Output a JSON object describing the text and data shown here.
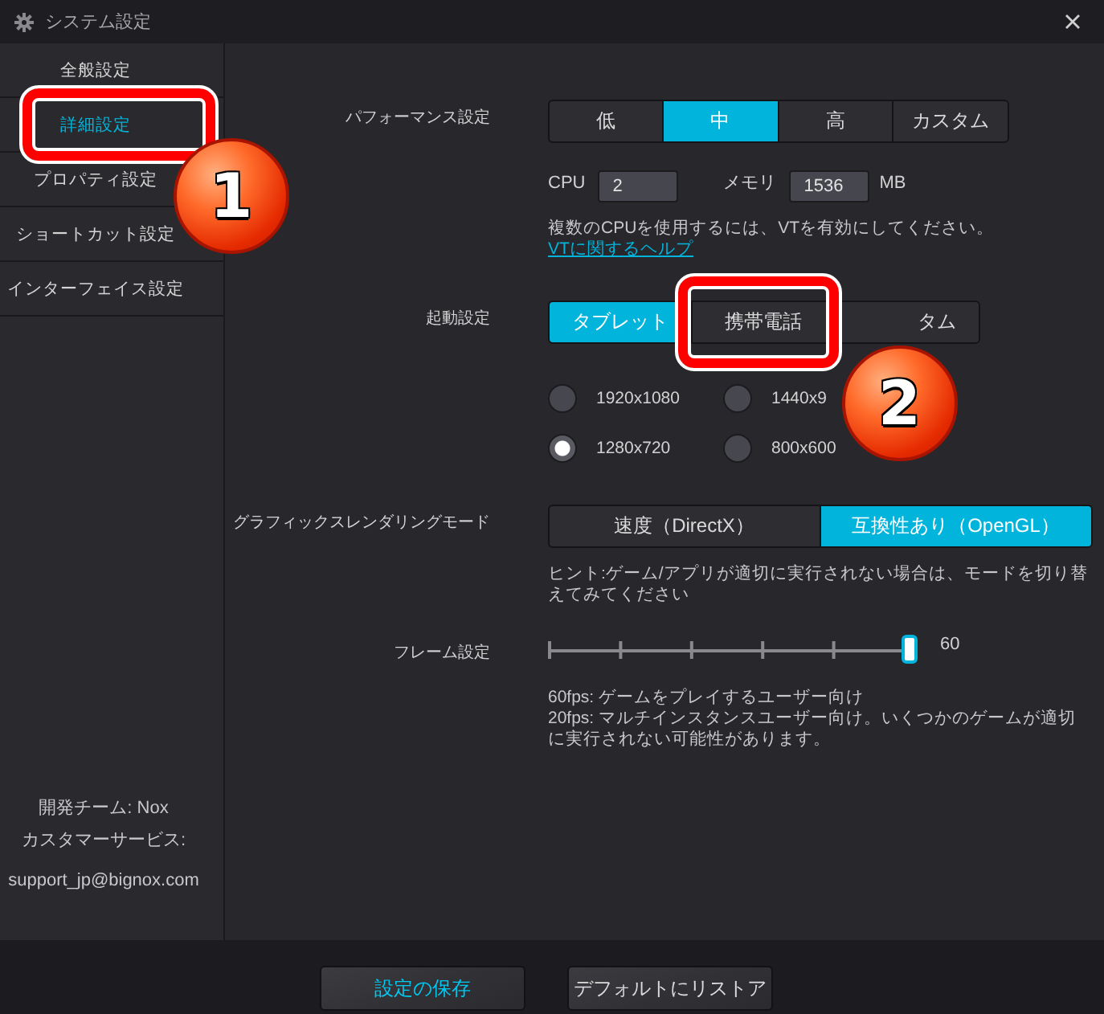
{
  "window": {
    "title": "システム設定"
  },
  "sidebar": {
    "items": [
      {
        "label": "全般設定",
        "selected": false
      },
      {
        "label": "詳細設定",
        "selected": true,
        "callout": "1"
      },
      {
        "label": "プロパティ設定",
        "selected": false
      },
      {
        "label": "ショートカット設定",
        "selected": false
      },
      {
        "label": "インターフェイス設定",
        "selected": false
      }
    ],
    "info": [
      "開発チーム: Nox",
      "カスタマーサービス:",
      "support_jp@bignox.com"
    ]
  },
  "performance": {
    "label": "パフォーマンス設定",
    "options": [
      {
        "label": "低",
        "selected": false
      },
      {
        "label": "中",
        "selected": true
      },
      {
        "label": "高",
        "selected": false
      },
      {
        "label": "カスタム",
        "selected": false
      }
    ],
    "cpu": {
      "label": "CPU",
      "value": "2"
    },
    "memory": {
      "label": "メモリ",
      "value": "1536",
      "unit": "MB"
    },
    "note": "複数のCPUを使用するには、VTを有効にしてください。",
    "link": "VTに関するヘルプ"
  },
  "startup": {
    "label": "起動設定",
    "options": [
      {
        "label": "タブレット",
        "selected": true
      },
      {
        "label": "携帯電話",
        "selected": false,
        "callout": "2"
      },
      {
        "label": "タム",
        "selected": false
      }
    ],
    "resolutions": [
      {
        "label": "1920x1080",
        "selected": false
      },
      {
        "label": "1440x9",
        "selected": false
      },
      {
        "label": "1280x720",
        "selected": true
      },
      {
        "label": "800x600",
        "selected": false
      }
    ]
  },
  "graphics": {
    "label": "グラフィックスレンダリングモード",
    "options": [
      {
        "label": "速度（DirectX）",
        "selected": false
      },
      {
        "label": "互換性あり（OpenGL）",
        "selected": true
      }
    ],
    "hint": "ヒント:ゲーム/アプリが適切に実行されない場合は、モードを切り替えてみてください"
  },
  "frame": {
    "label": "フレーム設定",
    "level": 1,
    "value": "60",
    "notes": [
      "60fps: ゲームをプレイするユーザー向け",
      "20fps: マルチインスタンスユーザー向け。いくつかのゲームが適切に実行されない可能性があります。"
    ]
  },
  "buttons": [
    {
      "label": "設定の保存",
      "kind": "primary"
    },
    {
      "label": "デフォルトにリストア",
      "kind": "secondary"
    }
  ]
}
